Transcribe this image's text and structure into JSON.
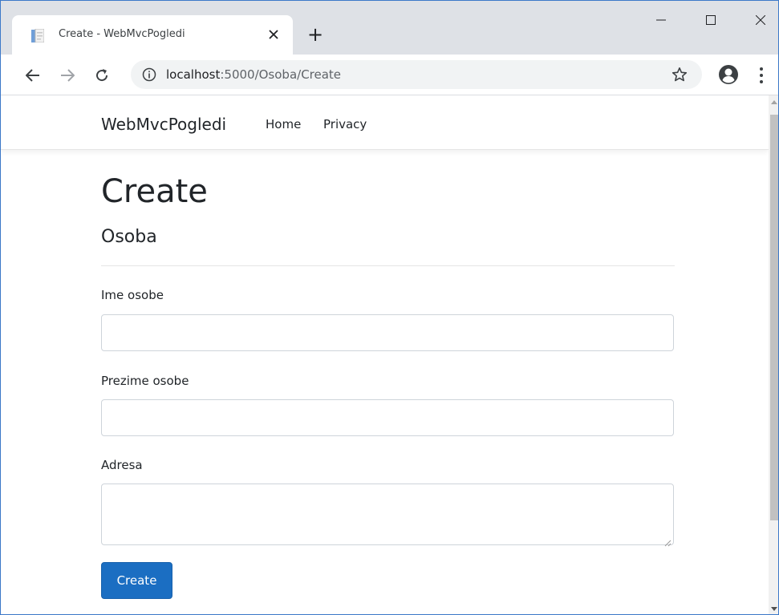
{
  "browser": {
    "tab_title": "Create - WebMvcPogledi",
    "new_tab_symbol": "+",
    "url_host": "localhost",
    "url_rest": ":5000/Osoba/Create"
  },
  "site": {
    "brand": "WebMvcPogledi",
    "nav": {
      "home": "Home",
      "privacy": "Privacy"
    }
  },
  "page": {
    "title": "Create",
    "subtitle": "Osoba"
  },
  "form": {
    "ime_label": "Ime osobe",
    "ime_value": "",
    "prezime_label": "Prezime osobe",
    "prezime_value": "",
    "adresa_label": "Adresa",
    "adresa_value": "",
    "submit_label": "Create"
  },
  "colors": {
    "primary_button": "#1b6ec2",
    "tabstrip": "#dee1e6",
    "text": "#212529"
  }
}
